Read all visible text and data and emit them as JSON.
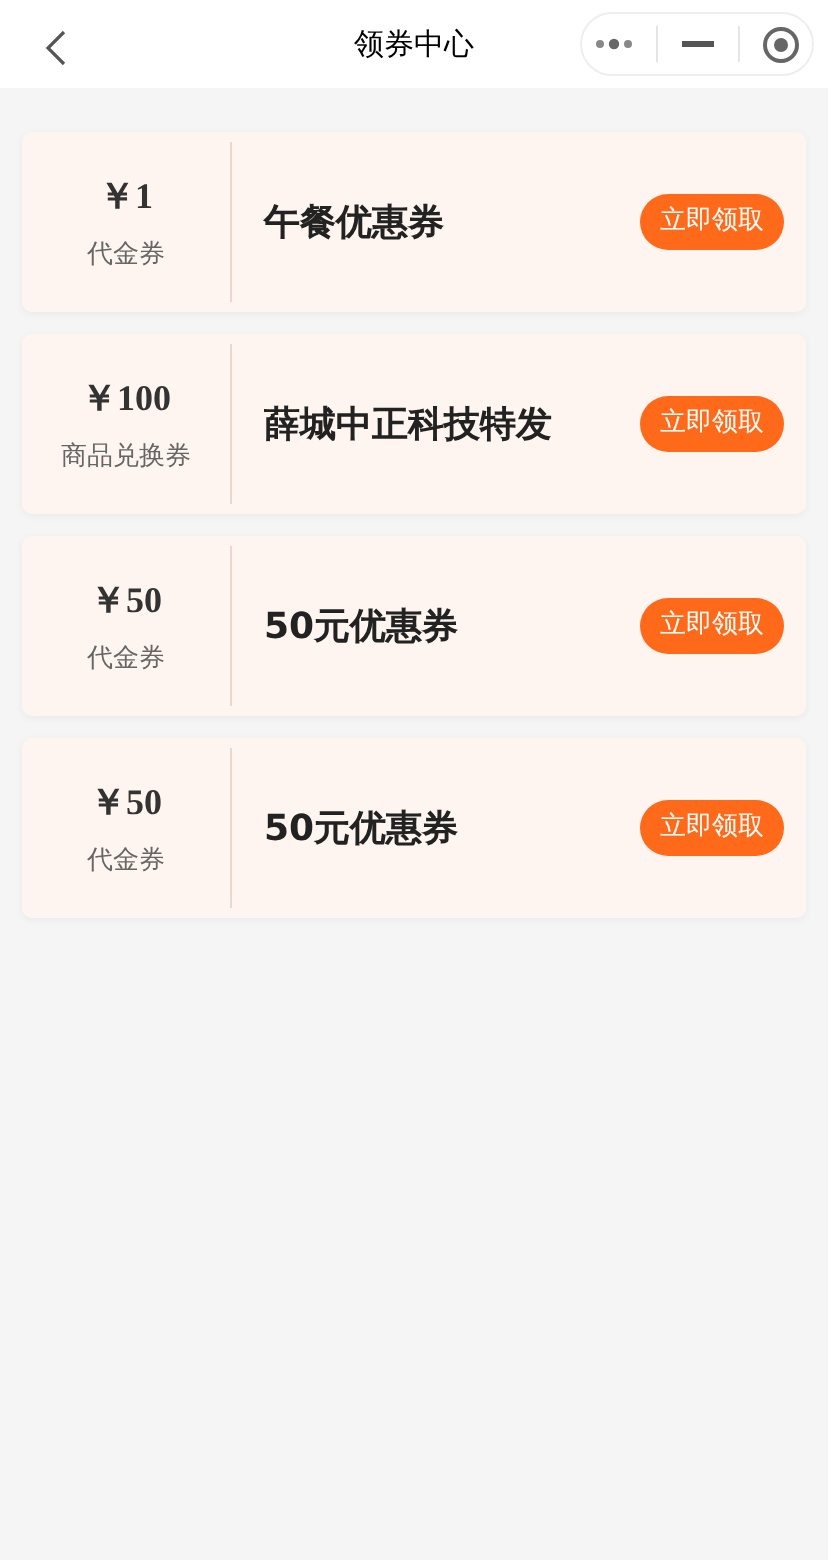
{
  "nav_bar": {
    "title": "领券中心"
  },
  "coupons": [
    {
      "amount": "￥1",
      "type": "代金券",
      "name": "午餐优惠券",
      "button": "立即领取"
    },
    {
      "amount": "￥100",
      "type": "商品兑换券",
      "name": "薛城中正科技特发",
      "button": "立即领取"
    },
    {
      "amount": "￥50",
      "type": "代金券",
      "name": "50元优惠券",
      "button": "立即领取"
    },
    {
      "amount": "￥50",
      "type": "代金券",
      "name": "50元优惠券",
      "button": "立即领取"
    }
  ]
}
